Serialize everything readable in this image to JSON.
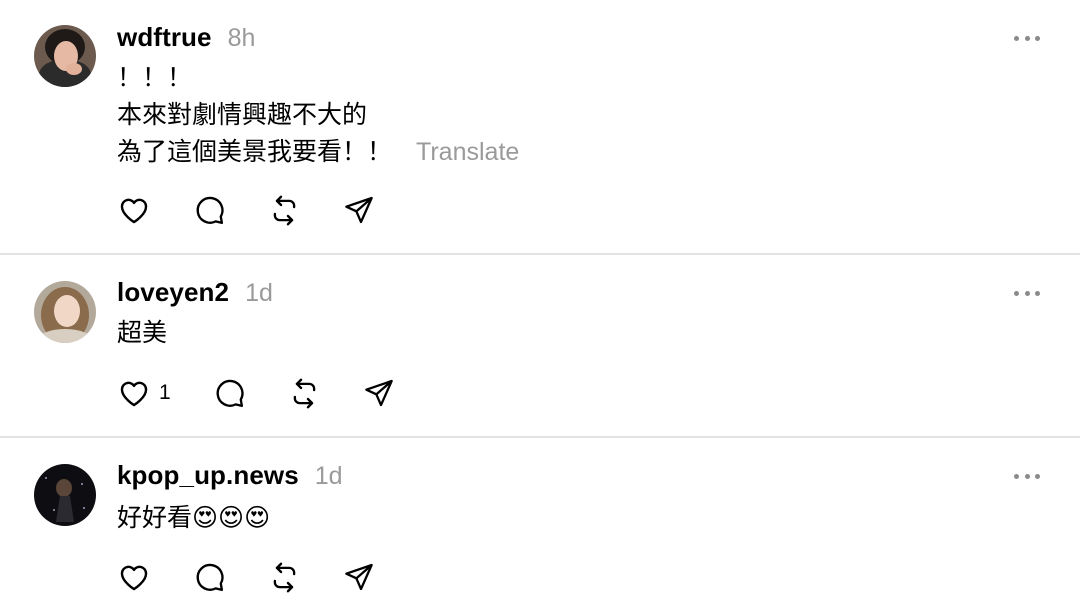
{
  "posts": [
    {
      "username": "wdftrue",
      "time": "8h",
      "lines": [
        "！！！",
        "本來對劇情興趣不大的",
        "為了這個美景我要看！！"
      ],
      "translate": "Translate",
      "like_count": "",
      "avatar": "avatar-woman-hand-on-chin"
    },
    {
      "username": "loveyen2",
      "time": "1d",
      "lines": [
        "超美"
      ],
      "like_count": "1",
      "avatar": "avatar-woman-long-hair"
    },
    {
      "username": "kpop_up.news",
      "time": "1d",
      "lines": [
        "好好看😍😍😍"
      ],
      "like_count": "",
      "avatar": "avatar-dark-silhouette"
    }
  ],
  "icons": {
    "like": "heart-icon",
    "comment": "comment-bubble-icon",
    "repost": "repost-icon",
    "share": "send-icon",
    "more": "more-dots-icon"
  },
  "colors": {
    "text": "#000000",
    "muted": "#9a9a9a",
    "divider": "#e3e3e3"
  }
}
